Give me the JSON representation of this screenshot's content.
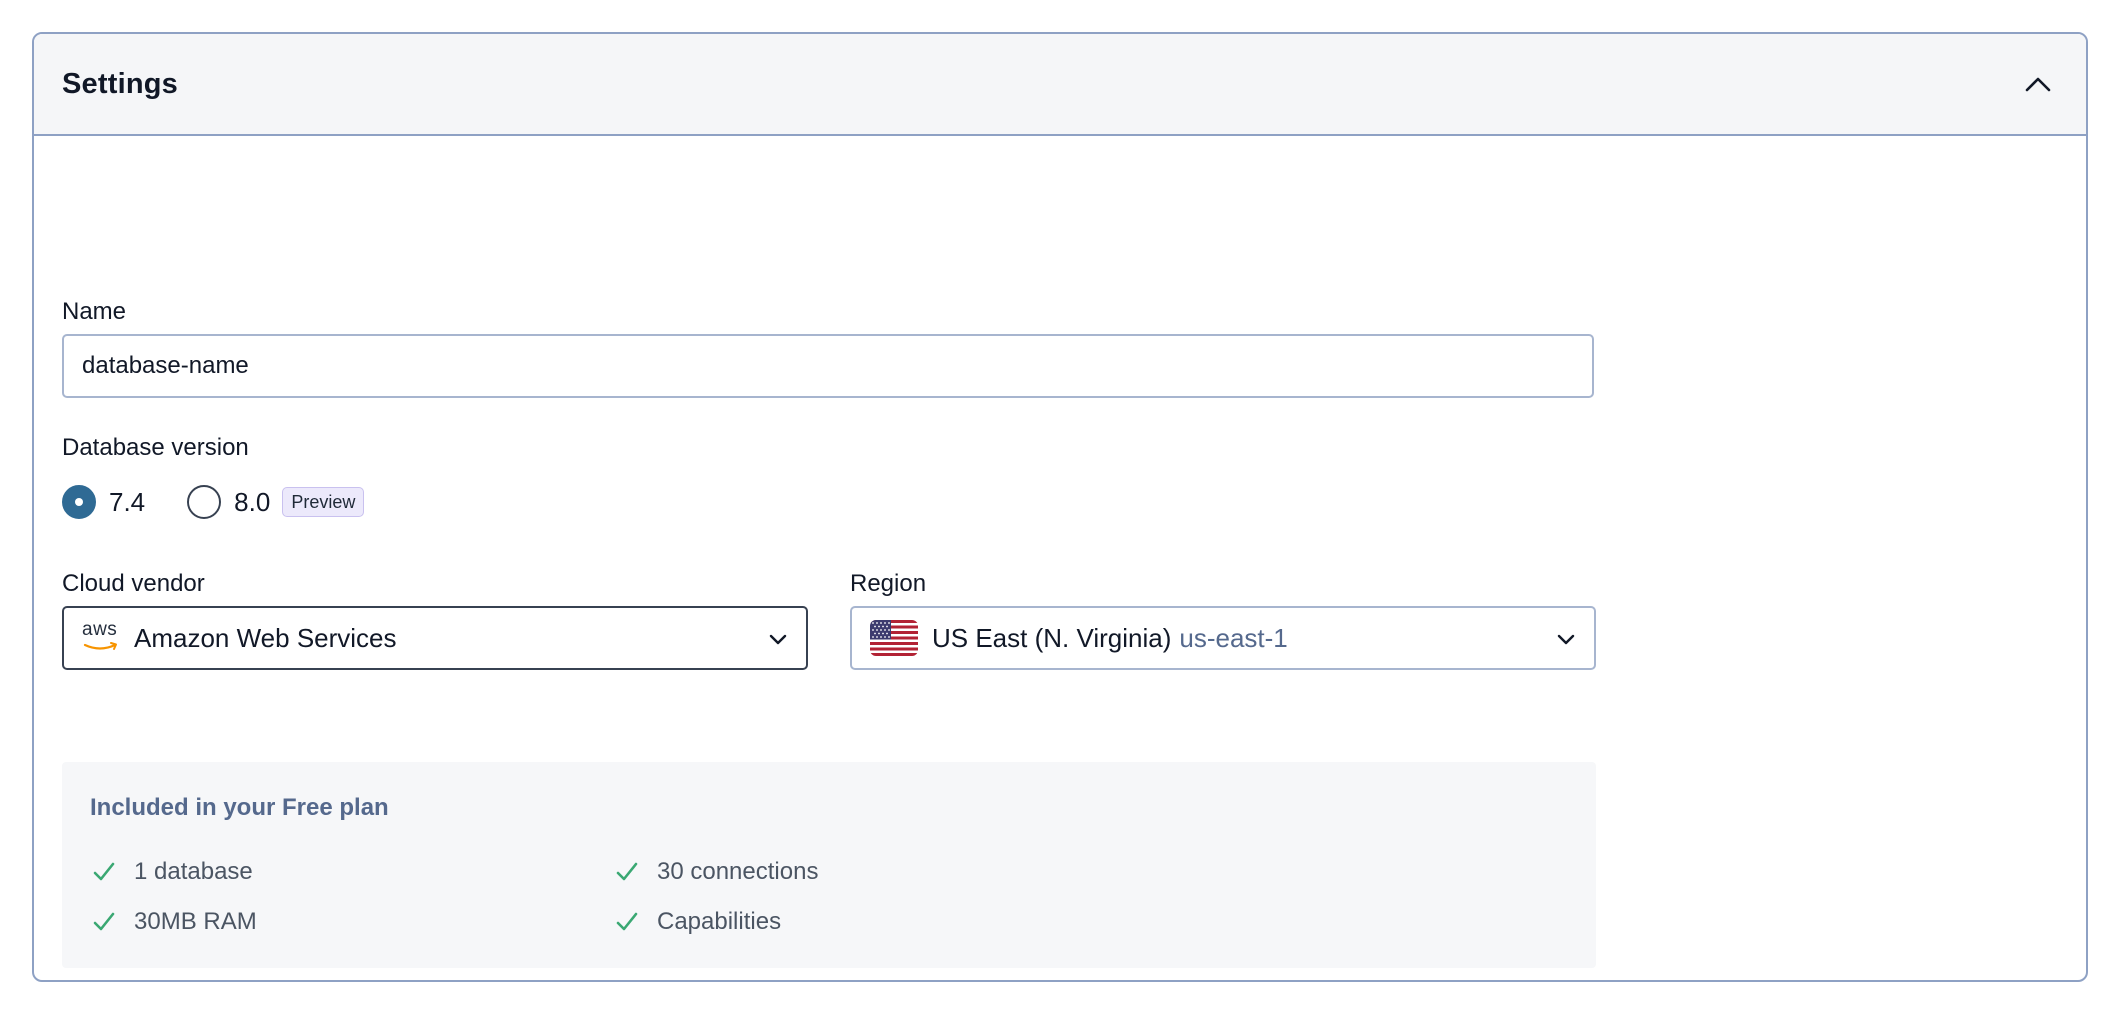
{
  "header": {
    "title": "Settings"
  },
  "form": {
    "name_label": "Name",
    "name_value": "database-name",
    "version_label": "Database version",
    "versions": [
      {
        "label": "7.4",
        "checked": true
      },
      {
        "label": "8.0",
        "checked": false,
        "badge": "Preview"
      }
    ],
    "vendor_label": "Cloud vendor",
    "vendor_value": "Amazon Web Services",
    "vendor_logo_text": "aws",
    "region_label": "Region",
    "region_value": "US East (N. Virginia)",
    "region_code": "us-east-1"
  },
  "plan": {
    "title": "Included in your Free plan",
    "items": [
      "1 database",
      "30 connections",
      "30MB RAM",
      "Capabilities"
    ]
  },
  "colors": {
    "accent": "#2f6a94",
    "check": "#3aa873",
    "border": "#8ea1c4",
    "muted_text": "#55698d"
  }
}
